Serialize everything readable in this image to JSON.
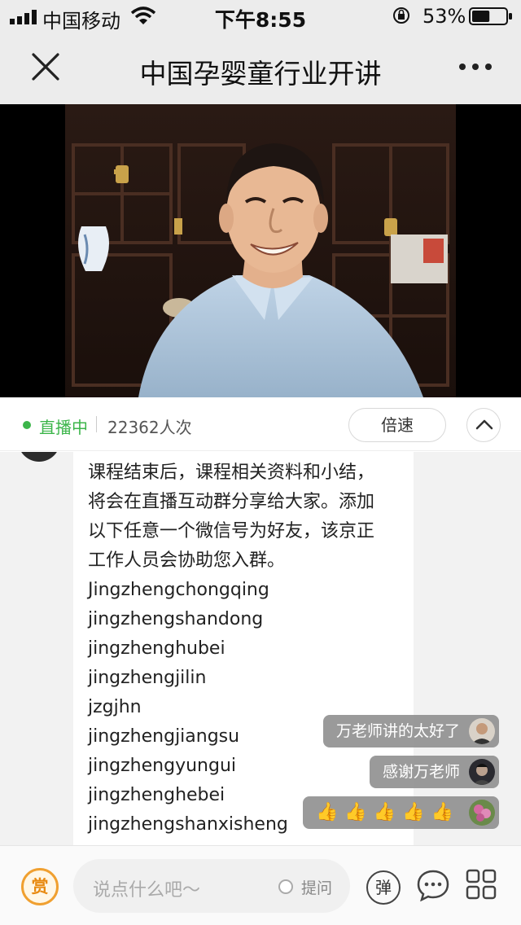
{
  "status_bar": {
    "carrier": "中国移动",
    "time": "下午8:55",
    "battery_percent": "53%",
    "battery_level": 0.53,
    "signal_icon": "signal-bars-icon",
    "wifi_icon": "wifi-icon",
    "lock_icon": "orientation-lock-icon"
  },
  "nav": {
    "title": "中国孕婴童行业开讲",
    "close_icon": "close-icon",
    "more_icon": "more-icon"
  },
  "live": {
    "status_label": "直播中",
    "viewer_count": "22362人次",
    "speed_label": "倍速",
    "status_color": "#3cb54a"
  },
  "message": {
    "lines": [
      "课程结束后，课程相关资料和小结，",
      "将会在直播互动群分享给大家。添加",
      "以下任意一个微信号为好友，该京正",
      "工作人员会协助您入群。",
      "Jingzhengchongqing",
      "jingzhengshandong",
      "jingzhenghubei",
      "jingzhengjilin",
      "jzgjhn",
      "jingzhengjiangsu",
      "jingzhengyungui",
      "jingzhenghebei",
      "jingzhengshanxisheng"
    ]
  },
  "floating_comments": [
    {
      "text": "万老师讲的太好了"
    },
    {
      "text": "感谢万老师"
    },
    {
      "text": "👍👍👍👍👍"
    }
  ],
  "bottom_bar": {
    "reward_label": "赏",
    "input_placeholder": "说点什么吧～",
    "question_label": "提问",
    "danmaku_label": "弹",
    "accent_color": "#f0a030"
  }
}
